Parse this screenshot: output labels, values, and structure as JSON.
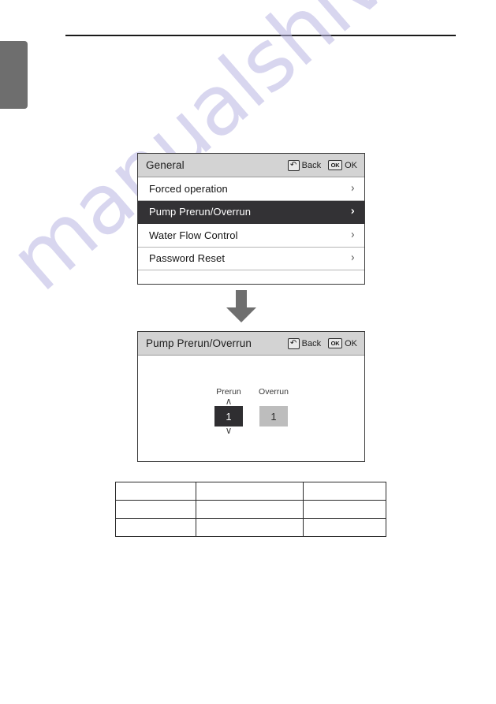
{
  "page": {
    "watermark_text": "manualshive.com",
    "accent_dark": "#333235",
    "header_gray": "#d3d3d3",
    "tab_gray": "#6e6e6e",
    "watermark_color": "#b9b6e2"
  },
  "menu_screen": {
    "title": "General",
    "actions": [
      {
        "key_glyph": "↶",
        "icon_name": "back-key-icon",
        "label": "Back"
      },
      {
        "key_glyph": "OK",
        "icon_name": "ok-key-icon",
        "label": "OK"
      }
    ],
    "items": [
      {
        "label": "Forced operation",
        "chevron": "›",
        "selected": false
      },
      {
        "label": "Pump Prerun/Overrun",
        "chevron": "›",
        "selected": true
      },
      {
        "label": "Water Flow Control",
        "chevron": "›",
        "selected": false
      },
      {
        "label": "Password Reset",
        "chevron": "›",
        "selected": false
      }
    ]
  },
  "detail_screen": {
    "title": "Pump Prerun/Overrun",
    "actions": [
      {
        "key_glyph": "↶",
        "icon_name": "back-key-icon",
        "label": "Back"
      },
      {
        "key_glyph": "OK",
        "icon_name": "ok-key-icon",
        "label": "OK"
      }
    ],
    "fields": [
      {
        "caption": "Prerun",
        "value": "1",
        "state": "active",
        "up_arrow": "∧",
        "down_arrow": "∨"
      },
      {
        "caption": "Overrun",
        "value": "1",
        "state": "inactive",
        "up_arrow": "",
        "down_arrow": ""
      }
    ]
  },
  "spec_table": {
    "rows": [
      [
        "",
        "",
        ""
      ],
      [
        "",
        "",
        ""
      ],
      [
        "",
        "",
        ""
      ]
    ]
  }
}
